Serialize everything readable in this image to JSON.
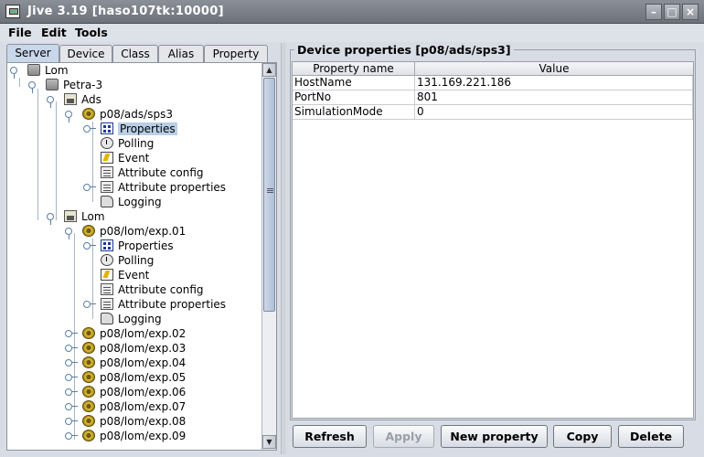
{
  "window": {
    "title": "Jive 3.19  [haso107tk:10000]"
  },
  "menu": [
    "File",
    "Edit",
    "Tools"
  ],
  "tabs": [
    "Server",
    "Device",
    "Class",
    "Alias",
    "Property"
  ],
  "tree": {
    "root": "Lom",
    "server": "Petra-3",
    "groups": [
      {
        "name": "Ads",
        "devices": [
          {
            "name": "p08/ads/sps3",
            "children": [
              "Properties",
              "Polling",
              "Event",
              "Attribute config",
              "Attribute properties",
              "Logging"
            ]
          }
        ]
      },
      {
        "name": "Lom",
        "devices": [
          {
            "name": "p08/lom/exp.01",
            "children": [
              "Properties",
              "Polling",
              "Event",
              "Attribute config",
              "Attribute properties",
              "Logging"
            ]
          },
          {
            "name": "p08/lom/exp.02"
          },
          {
            "name": "p08/lom/exp.03"
          },
          {
            "name": "p08/lom/exp.04"
          },
          {
            "name": "p08/lom/exp.05"
          },
          {
            "name": "p08/lom/exp.06"
          },
          {
            "name": "p08/lom/exp.07"
          },
          {
            "name": "p08/lom/exp.08"
          },
          {
            "name": "p08/lom/exp.09"
          }
        ]
      }
    ],
    "selected": "Properties"
  },
  "panel": {
    "title": "Device properties [p08/ads/sps3]",
    "columns": [
      "Property name",
      "Value"
    ],
    "rows": [
      [
        "HostName",
        "131.169.221.186"
      ],
      [
        "PortNo",
        "801"
      ],
      [
        "SimulationMode",
        "0"
      ]
    ]
  },
  "buttons": {
    "refresh": "Refresh",
    "apply": "Apply",
    "new_property": "New property",
    "copy": "Copy",
    "delete": "Delete"
  },
  "colors": {
    "selection": "#b8cfe5",
    "tree_line": "#5b7fa6"
  }
}
